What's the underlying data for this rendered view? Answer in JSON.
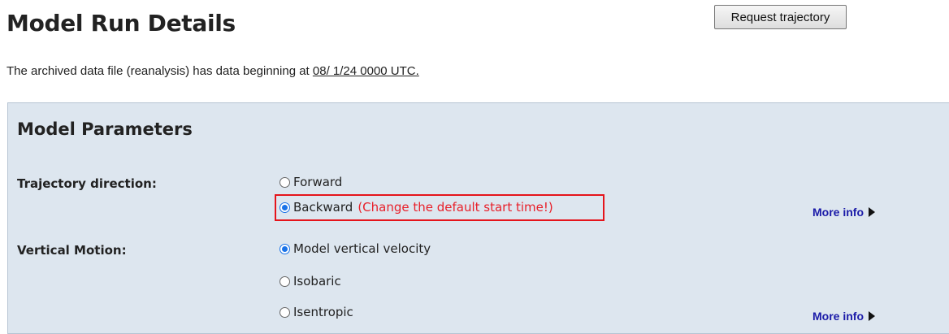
{
  "header": {
    "title": "Model Run Details",
    "request_button": "Request trajectory"
  },
  "notice": {
    "text": "The archived data file (reanalysis) has data beginning at ",
    "date": "08/ 1/24 0000 UTC."
  },
  "panel": {
    "title": "Model Parameters",
    "trajectory_direction": {
      "label": "Trajectory direction:",
      "options": [
        {
          "label": "Forward",
          "selected": false
        },
        {
          "label": "Backward",
          "selected": true
        }
      ],
      "annotation": "(Change the default start time!)",
      "more_info": "More info"
    },
    "vertical_motion": {
      "label": "Vertical Motion:",
      "options": [
        {
          "label": "Model vertical velocity",
          "selected": true
        },
        {
          "label": "Isobaric",
          "selected": false
        },
        {
          "label": "Isentropic",
          "selected": false
        }
      ],
      "more_info": "More info"
    }
  },
  "colors": {
    "panel_bg": "#dde6ef",
    "radio_selected": "#1a73e8",
    "annotation": "#e8202a",
    "highlight_box": "#e5141b",
    "link": "#1a1aa8"
  },
  "icons": {
    "radio": "radio-button-icon",
    "more_info_arrow": "triangle-right-icon"
  }
}
